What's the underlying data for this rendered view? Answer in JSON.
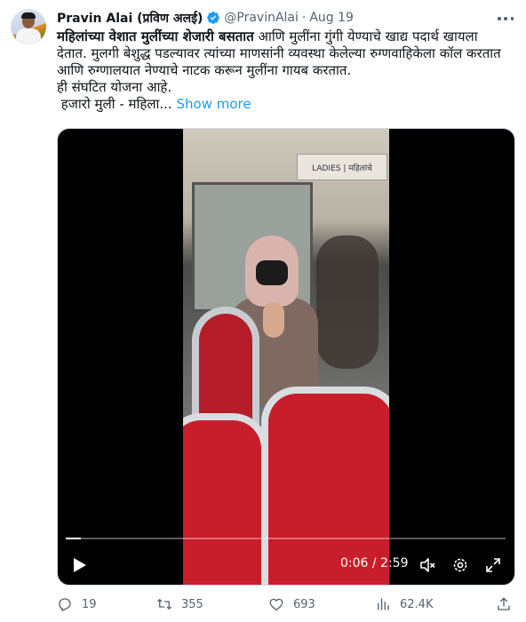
{
  "author": {
    "name": "Pravin Alai (प्रविण अलई)",
    "handle": "@PravinAlai",
    "separator": "·",
    "time": "Aug 19"
  },
  "tweet": {
    "bold_text": "महिलांच्या वेशात मुलींच्या शेजारी बसतात",
    "text_rest": " आणि मुलींना गुंगी येण्याचे खाद्य पदार्थ खायला देतात. मुलगी बेशुद्ध पडल्यावर त्यांच्या माणसांनी व्यवस्था केलेल्या रुग्णवाहिकेला कॉल करतात आणि रुग्णालयात नेण्याचे नाटक करून मुलींना गायब करतात.",
    "line2": "ही संघटित योजना आहे.",
    "line3": " हजारो मुली - महिला...",
    "show_more": "Show more"
  },
  "video": {
    "sign_text": "LADIES | महिलांचे",
    "timecode": "0:06 / 2:59",
    "progress": 0.034
  },
  "actions": {
    "replies": "19",
    "retweets": "355",
    "likes": "693",
    "views": "62.4K"
  },
  "colors": {
    "accent": "#1d9bf0",
    "muted": "#536471",
    "text": "#0f1419"
  }
}
